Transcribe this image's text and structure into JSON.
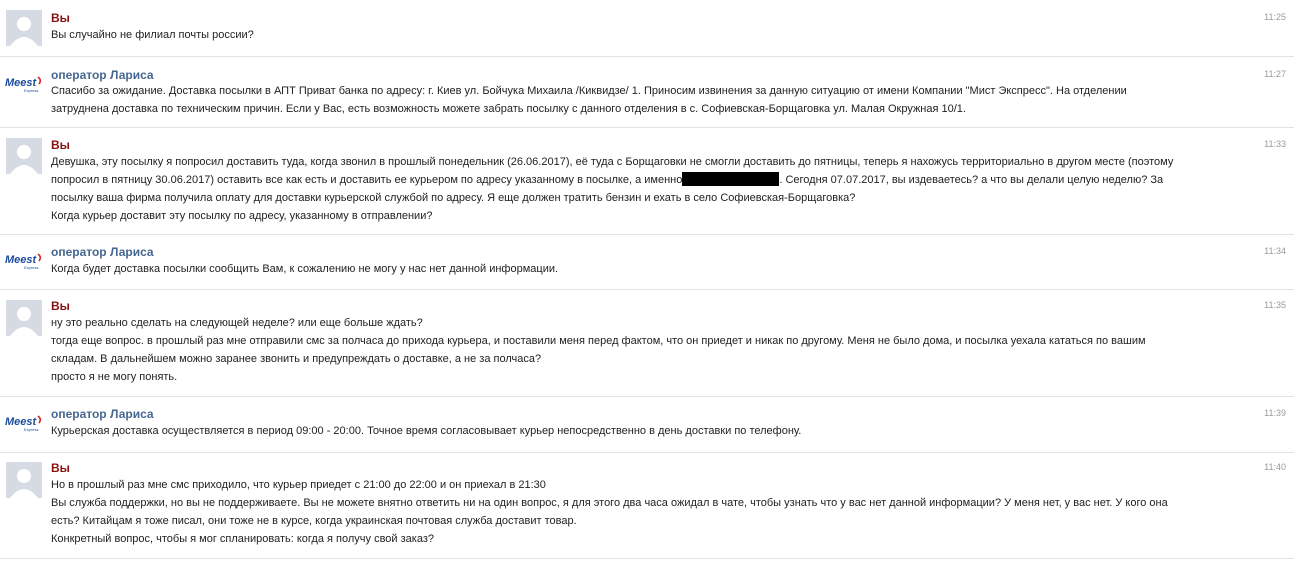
{
  "messages": [
    {
      "author": "Вы",
      "time": "11:25",
      "lines": [
        "Вы случайно не филиал почты россии?"
      ]
    },
    {
      "author": "оператор Лариса",
      "time": "11:27",
      "lines": [
        "Спасибо за ожидание. Доставка посылки в АПТ Приват банка по адресу: г. Киев ул. Бойчука Михаила /Киквидзе/ 1. Приносим извинения за данную ситуацию от имени Компании \"Мист Экспресс\". На отделении",
        "затруднена доставка по техническим причин. Если у Вас, есть возможность можете забрать посылку с данного отделения в с. Софиевская-Борщаговка ул. Малая Окружная 10/1."
      ]
    },
    {
      "author": "Вы",
      "time": "11:33",
      "lines": [
        "Девушка, эту посылку я попросил доставить туда, когда звонил в прошлый понедельник (26.06.2017), её туда с Борщаговки не смогли доставить до пятницы, теперь я нахожусь территориально в другом месте (поэтому",
        "попросил в пятницу 30.06.2017) оставить все как есть и доставить ее курьером по адресу указанному в посылке, а именно",
        ". Сегодня 07.07.2017, вы издеваетесь? а что вы делали целую неделю? За",
        "посылку ваша фирма получила оплату для доставки курьерской службой по адресу. Я еще должен тратить бензин и ехать в село Софиевская-Борщаговка?",
        "Когда курьер доставит эту посылку по адресу, указанному в отправлении?"
      ]
    },
    {
      "author": "оператор Лариса",
      "time": "11:34",
      "lines": [
        "Когда будет доставка посылки сообщить Вам, к сожалению не могу у нас нет данной информации."
      ]
    },
    {
      "author": "Вы",
      "time": "11:35",
      "lines": [
        "ну это реально сделать на следующей неделе? или еще больше ждать?",
        "тогда еще вопрос. в прошлый раз мне отправили смс за полчаса до прихода курьера, и поставили меня перед фактом, что он приедет и никак по другому. Меня не было дома, и посылка уехала кататься по вашим",
        "складам. В дальнейшем можно заранее звонить и предупреждать о доставке, а не за полчаса?",
        "просто я не могу понять."
      ]
    },
    {
      "author": "оператор Лариса",
      "time": "11:39",
      "lines": [
        "Курьерская доставка осуществляется в период 09:00 - 20:00. Точное время согласовывает курьер непосредственно в день доставки по телефону."
      ]
    },
    {
      "author": "Вы",
      "time": "11:40",
      "lines": [
        "Но в прошлый раз мне смс приходило, что курьер приедет с 21:00 до 22:00 и он приехал в 21:30",
        "Вы служба поддержки, но вы не поддерживаете. Вы не можете внятно ответить ни на один вопрос, я для этого два часа ожидал в чате, чтобы узнать что у вас нет данной информации? У меня нет, у вас нет. У кого она",
        "есть? Китайцам я тоже писал, они тоже не в курсе, когда украинская почтовая служба доставит товар.",
        "Конкретный вопрос, чтобы я мог спланировать: когда я получу свой заказ?"
      ]
    }
  ],
  "operator_logo": {
    "text": "Meest",
    "sub": "Express"
  },
  "colors": {
    "user_name": "#8b1010",
    "operator_name": "#45678f",
    "logo_blue": "#1a4b9c",
    "logo_red": "#d7262e"
  }
}
